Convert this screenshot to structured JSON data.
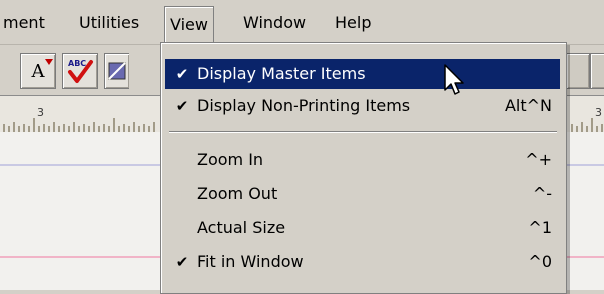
{
  "menubar": {
    "items": [
      {
        "label": "ment"
      },
      {
        "label": "Utilities"
      },
      {
        "label": "View"
      },
      {
        "label": "Window"
      },
      {
        "label": "Help"
      }
    ]
  },
  "toolbar": {
    "buttons": [
      {
        "icon": "text-size-icon",
        "label": "A"
      },
      {
        "icon": "spell-check-icon",
        "label": "ABC"
      },
      {
        "icon": "color-swatch-icon",
        "label": ""
      }
    ]
  },
  "ruler": {
    "labels": [
      "3",
      "3"
    ]
  },
  "view_menu": {
    "items": [
      {
        "label": "Display Master Items",
        "shortcut": "",
        "checked": true,
        "highlighted": true
      },
      {
        "label": "Display Non-Printing Items",
        "shortcut": "Alt^N",
        "checked": true,
        "highlighted": false
      },
      {
        "label": "Zoom In",
        "shortcut": "^+",
        "checked": false,
        "highlighted": false
      },
      {
        "label": "Zoom Out",
        "shortcut": "^-",
        "checked": false,
        "highlighted": false
      },
      {
        "label": "Actual Size",
        "shortcut": "^1",
        "checked": false,
        "highlighted": false
      },
      {
        "label": "Fit in Window",
        "shortcut": "^0",
        "checked": true,
        "highlighted": false
      }
    ],
    "check_glyph": "✔"
  },
  "colors": {
    "menu_face": "#d4d0c8",
    "highlight": "#0a246a",
    "doc_guide_blue": "#c9c9e3",
    "doc_guide_pink": "#f1b4c7"
  }
}
